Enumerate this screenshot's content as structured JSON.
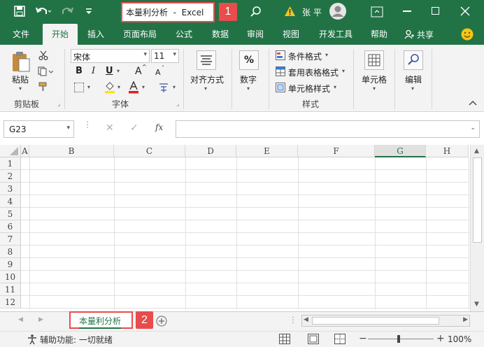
{
  "titlebar": {
    "doc_title": "本量利分析  -  Excel",
    "user_name": "张 平",
    "callout1": "1"
  },
  "tabs": [
    "文件",
    "开始",
    "插入",
    "页面布局",
    "公式",
    "数据",
    "审阅",
    "视图",
    "开发工具",
    "帮助"
  ],
  "share_label": "共享",
  "clipboard": {
    "paste_label": "粘贴",
    "group_label": "剪贴板"
  },
  "font_group": {
    "font_name": "宋体",
    "font_size": "11",
    "group_label": "字体",
    "bold": "B",
    "italic": "I",
    "underline": "U",
    "grow": "A",
    "shrink": "A"
  },
  "alignment": {
    "label": "对齐方式"
  },
  "number": {
    "label": "数字",
    "symbol": "%"
  },
  "styles": {
    "cond_format": "条件格式",
    "table_format": "套用表格格式",
    "cell_style": "单元格样式",
    "group_label": "样式"
  },
  "cells": {
    "label": "单元格"
  },
  "editing": {
    "label": "编辑"
  },
  "formula_bar": {
    "name_box": "G23",
    "fx": "fx",
    "cancel": "✕",
    "enter": "✓"
  },
  "columns": [
    "A",
    "B",
    "C",
    "D",
    "E",
    "F",
    "G",
    "H"
  ],
  "rows": [
    "1",
    "2",
    "3",
    "4",
    "5",
    "6",
    "7",
    "8",
    "9",
    "10",
    "11",
    "12"
  ],
  "sheet": {
    "tab_name": "本量利分析",
    "callout2": "2"
  },
  "status": {
    "text": "辅助功能: 一切就绪",
    "zoom": "100%"
  }
}
